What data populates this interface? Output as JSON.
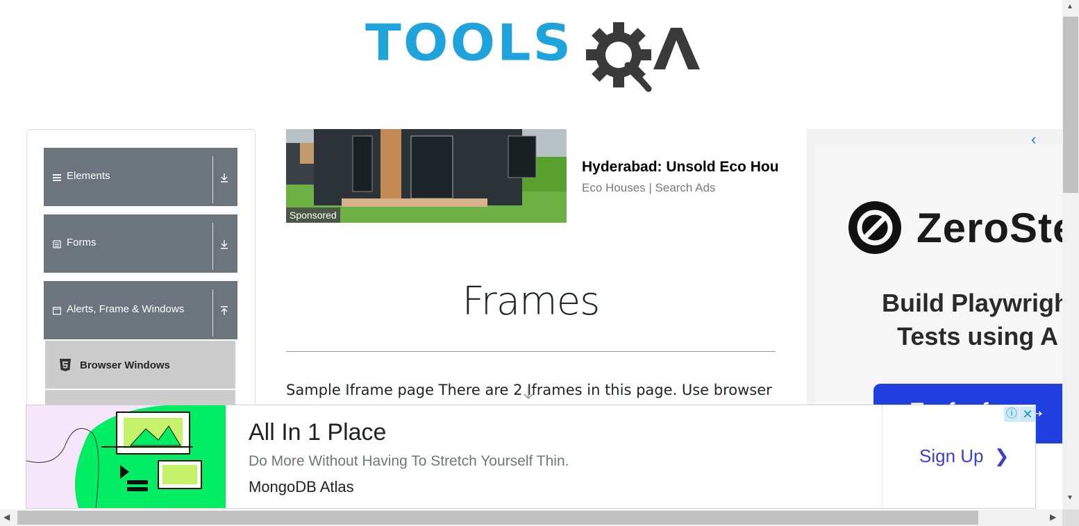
{
  "logo": {
    "text_tools": "TOOLS",
    "text_qa": "QA"
  },
  "sidebar": {
    "groups": [
      {
        "label": "Elements",
        "icon": "menu-icon",
        "arrow": "download-arrow-icon"
      },
      {
        "label": "Forms",
        "icon": "form-icon",
        "arrow": "download-arrow-icon"
      },
      {
        "label": "Alerts, Frame & Windows",
        "icon": "window-icon",
        "arrow": "upload-arrow-icon"
      }
    ],
    "active_item": {
      "label": "Browser Windows",
      "icon": "html5-icon"
    }
  },
  "ad_top": {
    "badge": "Sponsored",
    "headline": "Hyderabad: Unsold Eco Hou",
    "source": "Eco Houses | Search Ads"
  },
  "main": {
    "title": "Frames",
    "text": "Sample Iframe page There are 2 Iframes in this page. Use browser"
  },
  "ad_right": {
    "brand": "ZeroSte",
    "headline_line1": "Build Playwrigh",
    "headline_line2": "Tests using A",
    "cta": "Try for free →",
    "back_icon": "‹"
  },
  "ad_bottom": {
    "title": "All In 1 Place",
    "description": "Do More Without Having To Stretch Yourself Thin.",
    "brand": "MongoDB Atlas",
    "cta": "Sign Up",
    "cta_icon": "❯",
    "info_icon": "ⓘ",
    "close_icon": "✕"
  },
  "colors": {
    "accent_blue": "#1ea3dc",
    "sidebar_group": "#6c757d",
    "sidebar_active": "#cccccc",
    "cta_blue": "#1f3fe0",
    "mongodb_green": "#00ed64"
  }
}
